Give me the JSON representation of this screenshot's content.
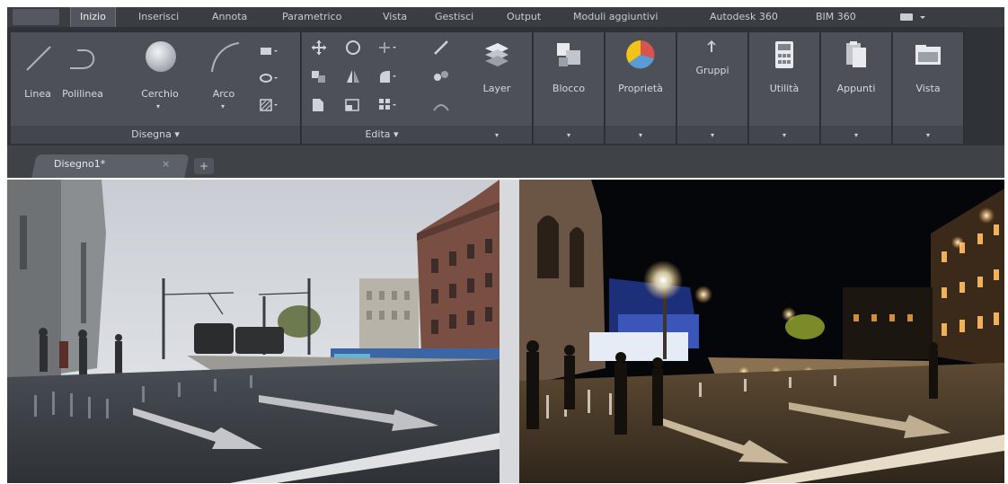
{
  "menu": {
    "tabs": [
      "Inizio",
      "Inserisci",
      "Annota",
      "Parametrico",
      "Vista",
      "Gestisci",
      "Output",
      "Moduli aggiuntivi",
      "Autodesk 360",
      "BIM 360"
    ],
    "active_tab": "Inizio"
  },
  "ribbon": {
    "draw": {
      "label": "Disegna ▾",
      "tools": [
        "Linea",
        "Polilinea",
        "Cerchio",
        "Arco"
      ]
    },
    "modify": {
      "label": "Edita ▾"
    },
    "panels": [
      "Layer",
      "Blocco",
      "Proprietà",
      "Gruppi",
      "Utilità",
      "Appunti",
      "Vista"
    ]
  },
  "document": {
    "tab_label": "Disegno1*",
    "close_glyph": "×",
    "new_tab_glyph": "+"
  },
  "viewport": {
    "left_scene": "day",
    "right_scene": "night"
  },
  "colors": {
    "ribbon_bg": "#2f3237",
    "panel_bg": "#4d5157",
    "text": "#d6d9de",
    "accent": "#8ab4e6"
  }
}
